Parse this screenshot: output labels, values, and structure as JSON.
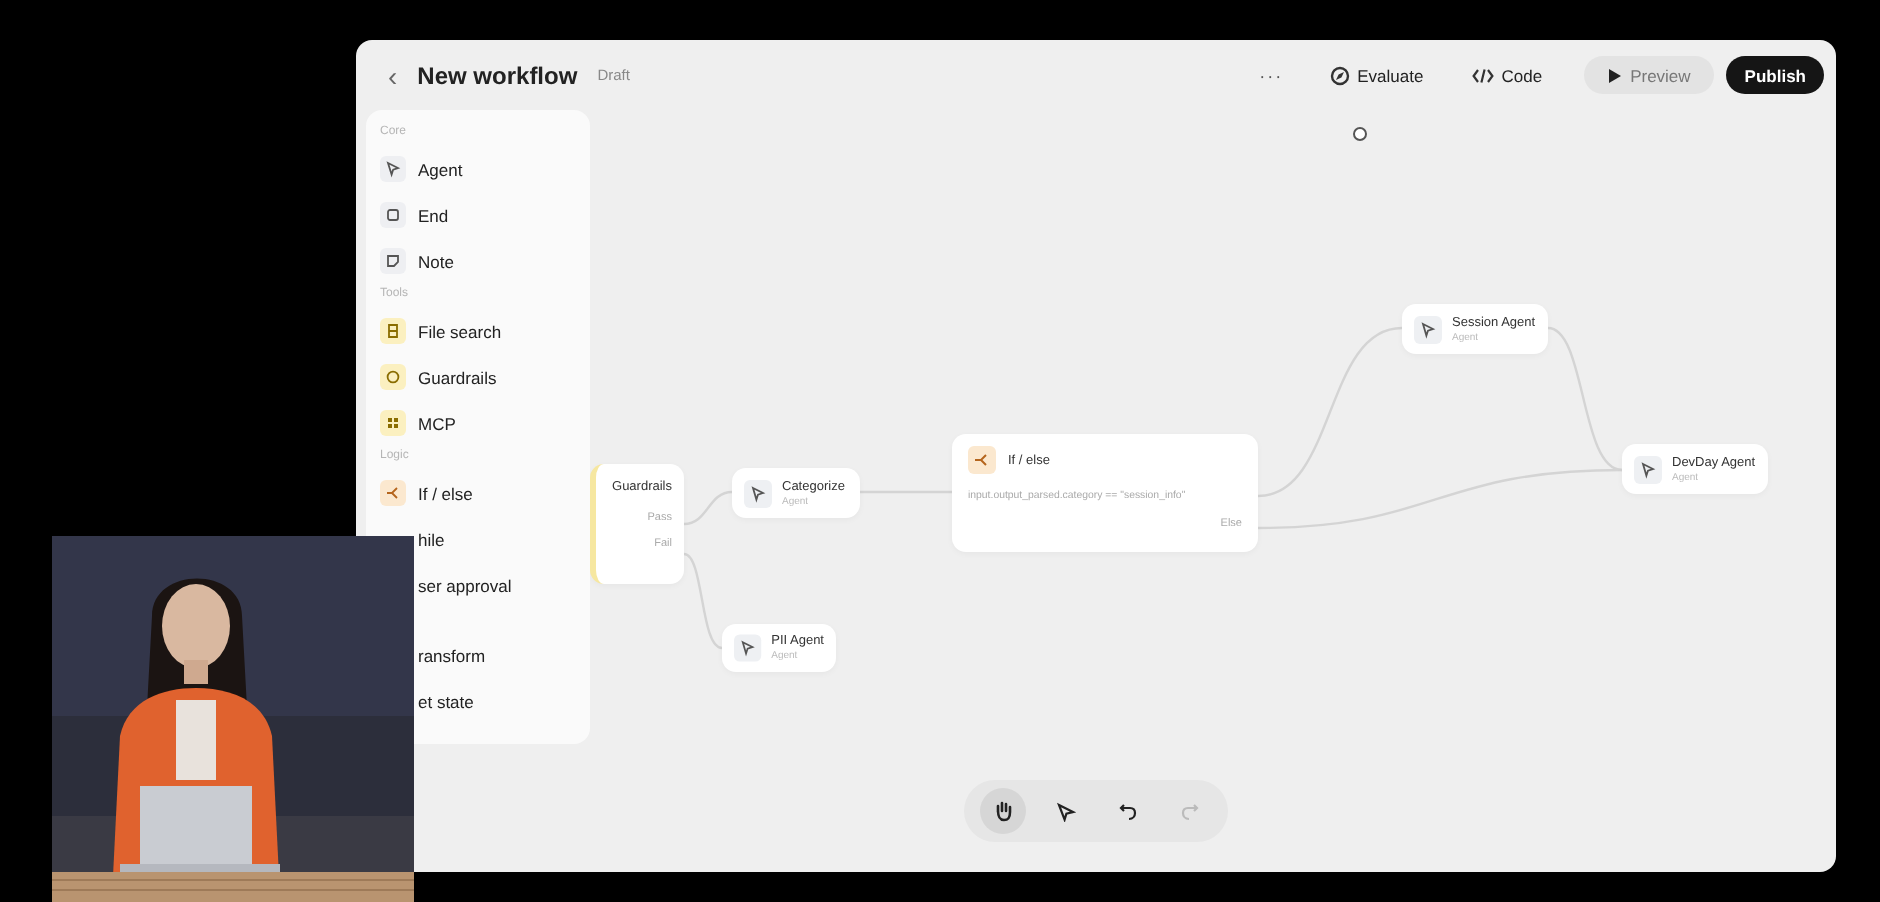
{
  "header": {
    "back": "‹",
    "title": "New workflow",
    "status": "Draft",
    "more": "···",
    "actions": [
      {
        "label": "Evaluate",
        "kind": "evaluate"
      },
      {
        "label": "Code",
        "kind": "code"
      },
      {
        "label": "Preview",
        "kind": "preview"
      },
      {
        "label": "Publish",
        "kind": "publish"
      }
    ]
  },
  "sidebar": {
    "sections": [
      {
        "heading": "Core",
        "items": [
          {
            "label": "Agent"
          },
          {
            "label": "End"
          },
          {
            "label": "Note"
          }
        ]
      },
      {
        "heading": "Tools",
        "items": [
          {
            "label": "File search"
          },
          {
            "label": "Guardrails"
          },
          {
            "label": "MCP"
          }
        ]
      },
      {
        "heading": "Logic",
        "items": [
          {
            "label": "If / else"
          },
          {
            "label": "hile"
          },
          {
            "label": "ser approval"
          }
        ]
      },
      {
        "items": [
          {
            "label": "ransform"
          },
          {
            "label": "et state"
          }
        ]
      }
    ]
  },
  "nodes": [
    {
      "kind": "guardrails",
      "title": "Guardrails",
      "outputs": [
        "Pass",
        "Fail"
      ]
    },
    {
      "kind": "agent",
      "title": "Categorize",
      "subtitle": "Agent"
    },
    {
      "kind": "agent",
      "title": "PII Agent",
      "subtitle": "Agent"
    },
    {
      "kind": "ifelse",
      "title": "If / else",
      "condition": "input.output_parsed.category == \"session_info\"",
      "else": "Else"
    },
    {
      "kind": "agent",
      "title": "Session Agent",
      "subtitle": "Agent"
    },
    {
      "kind": "agent",
      "title": "DevDay Agent",
      "subtitle": "Agent"
    }
  ],
  "toolbar": [
    {
      "kind": "hand",
      "selected": true
    },
    {
      "kind": "pointer",
      "selected": false
    },
    {
      "kind": "undo",
      "disabled": false
    },
    {
      "kind": "redo",
      "disabled": true
    }
  ]
}
